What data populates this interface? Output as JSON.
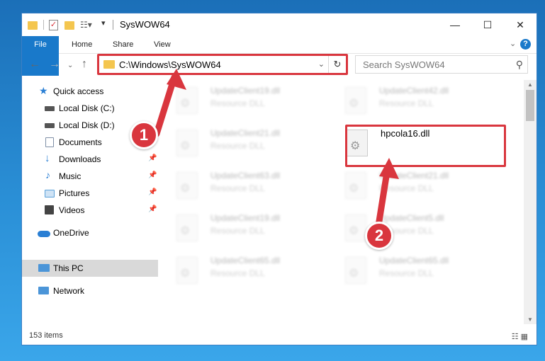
{
  "window": {
    "title": "SysWOW64",
    "controls": {
      "minimize": "—",
      "maximize": "☐",
      "close": "✕"
    }
  },
  "ribbon": {
    "tabs": [
      "File",
      "Home",
      "Share",
      "View"
    ],
    "help": "?"
  },
  "address": {
    "path": "C:\\Windows\\SysWOW64",
    "search_placeholder": "Search SysWOW64"
  },
  "sidebar": {
    "items": [
      {
        "label": "Quick access",
        "icon": "star-icon",
        "color": "#2a7fd4"
      },
      {
        "label": "Local Disk (C:)",
        "icon": "drive-icon",
        "color": "#555555"
      },
      {
        "label": "Local Disk (D:)",
        "icon": "drive-icon",
        "color": "#555555"
      },
      {
        "label": "Documents",
        "icon": "documents-icon",
        "color": "#7f8fa6"
      },
      {
        "label": "Downloads",
        "icon": "download-icon",
        "color": "#2a7fd4"
      },
      {
        "label": "Music",
        "icon": "music-icon",
        "color": "#2a7fd4"
      },
      {
        "label": "Pictures",
        "icon": "pictures-icon",
        "color": "#5aa0d8"
      },
      {
        "label": "Videos",
        "icon": "videos-icon",
        "color": "#444444"
      },
      {
        "label": "OneDrive",
        "icon": "cloud-icon",
        "color": "#2a7fd4"
      },
      {
        "label": "This PC",
        "icon": "computer-icon",
        "color": "#4b95d8"
      },
      {
        "label": "Network",
        "icon": "network-icon",
        "color": "#4b95d8"
      }
    ]
  },
  "files": [
    {
      "name": "UpdateClient19.dll",
      "type": "Resource DLL"
    },
    {
      "name": "UpdateClient42.dll",
      "type": "Resource DLL"
    },
    {
      "name": "UpdateClient21.dll",
      "type": "Resource DLL"
    },
    {
      "name": "hpcola16.dll",
      "type": ""
    },
    {
      "name": "UpdateClient63.dll",
      "type": "Resource DLL"
    },
    {
      "name": "UpdateClient21.dll",
      "type": "Resource DLL"
    },
    {
      "name": "UpdateClient19.dll",
      "type": "Resource DLL"
    },
    {
      "name": "UpdateClient5.dll",
      "type": "Resource DLL"
    },
    {
      "name": "UpdateClient65.dll",
      "type": "Resource DLL"
    },
    {
      "name": "UpdateClient65.dll",
      "type": "Resource DLL"
    }
  ],
  "status": {
    "count": "153 items"
  },
  "annotations": {
    "step1": "1",
    "step2": "2",
    "color": "#d9363e"
  }
}
